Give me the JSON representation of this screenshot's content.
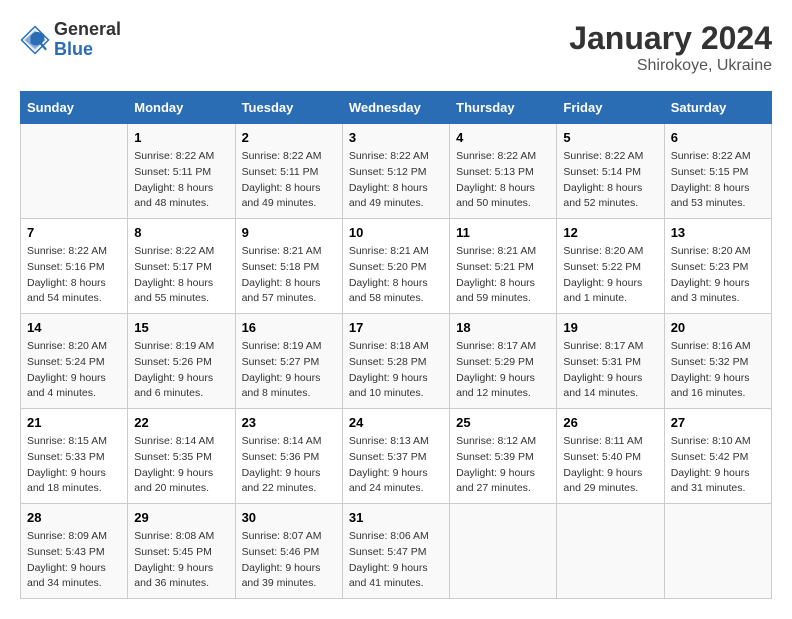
{
  "header": {
    "logo_general": "General",
    "logo_blue": "Blue",
    "title": "January 2024",
    "subtitle": "Shirokoye, Ukraine"
  },
  "columns": [
    "Sunday",
    "Monday",
    "Tuesday",
    "Wednesday",
    "Thursday",
    "Friday",
    "Saturday"
  ],
  "weeks": [
    [
      {
        "day": "",
        "sunrise": "",
        "sunset": "",
        "daylight": ""
      },
      {
        "day": "1",
        "sunrise": "Sunrise: 8:22 AM",
        "sunset": "Sunset: 5:11 PM",
        "daylight": "Daylight: 8 hours and 48 minutes."
      },
      {
        "day": "2",
        "sunrise": "Sunrise: 8:22 AM",
        "sunset": "Sunset: 5:11 PM",
        "daylight": "Daylight: 8 hours and 49 minutes."
      },
      {
        "day": "3",
        "sunrise": "Sunrise: 8:22 AM",
        "sunset": "Sunset: 5:12 PM",
        "daylight": "Daylight: 8 hours and 49 minutes."
      },
      {
        "day": "4",
        "sunrise": "Sunrise: 8:22 AM",
        "sunset": "Sunset: 5:13 PM",
        "daylight": "Daylight: 8 hours and 50 minutes."
      },
      {
        "day": "5",
        "sunrise": "Sunrise: 8:22 AM",
        "sunset": "Sunset: 5:14 PM",
        "daylight": "Daylight: 8 hours and 52 minutes."
      },
      {
        "day": "6",
        "sunrise": "Sunrise: 8:22 AM",
        "sunset": "Sunset: 5:15 PM",
        "daylight": "Daylight: 8 hours and 53 minutes."
      }
    ],
    [
      {
        "day": "7",
        "sunrise": "Sunrise: 8:22 AM",
        "sunset": "Sunset: 5:16 PM",
        "daylight": "Daylight: 8 hours and 54 minutes."
      },
      {
        "day": "8",
        "sunrise": "Sunrise: 8:22 AM",
        "sunset": "Sunset: 5:17 PM",
        "daylight": "Daylight: 8 hours and 55 minutes."
      },
      {
        "day": "9",
        "sunrise": "Sunrise: 8:21 AM",
        "sunset": "Sunset: 5:18 PM",
        "daylight": "Daylight: 8 hours and 57 minutes."
      },
      {
        "day": "10",
        "sunrise": "Sunrise: 8:21 AM",
        "sunset": "Sunset: 5:20 PM",
        "daylight": "Daylight: 8 hours and 58 minutes."
      },
      {
        "day": "11",
        "sunrise": "Sunrise: 8:21 AM",
        "sunset": "Sunset: 5:21 PM",
        "daylight": "Daylight: 8 hours and 59 minutes."
      },
      {
        "day": "12",
        "sunrise": "Sunrise: 8:20 AM",
        "sunset": "Sunset: 5:22 PM",
        "daylight": "Daylight: 9 hours and 1 minute."
      },
      {
        "day": "13",
        "sunrise": "Sunrise: 8:20 AM",
        "sunset": "Sunset: 5:23 PM",
        "daylight": "Daylight: 9 hours and 3 minutes."
      }
    ],
    [
      {
        "day": "14",
        "sunrise": "Sunrise: 8:20 AM",
        "sunset": "Sunset: 5:24 PM",
        "daylight": "Daylight: 9 hours and 4 minutes."
      },
      {
        "day": "15",
        "sunrise": "Sunrise: 8:19 AM",
        "sunset": "Sunset: 5:26 PM",
        "daylight": "Daylight: 9 hours and 6 minutes."
      },
      {
        "day": "16",
        "sunrise": "Sunrise: 8:19 AM",
        "sunset": "Sunset: 5:27 PM",
        "daylight": "Daylight: 9 hours and 8 minutes."
      },
      {
        "day": "17",
        "sunrise": "Sunrise: 8:18 AM",
        "sunset": "Sunset: 5:28 PM",
        "daylight": "Daylight: 9 hours and 10 minutes."
      },
      {
        "day": "18",
        "sunrise": "Sunrise: 8:17 AM",
        "sunset": "Sunset: 5:29 PM",
        "daylight": "Daylight: 9 hours and 12 minutes."
      },
      {
        "day": "19",
        "sunrise": "Sunrise: 8:17 AM",
        "sunset": "Sunset: 5:31 PM",
        "daylight": "Daylight: 9 hours and 14 minutes."
      },
      {
        "day": "20",
        "sunrise": "Sunrise: 8:16 AM",
        "sunset": "Sunset: 5:32 PM",
        "daylight": "Daylight: 9 hours and 16 minutes."
      }
    ],
    [
      {
        "day": "21",
        "sunrise": "Sunrise: 8:15 AM",
        "sunset": "Sunset: 5:33 PM",
        "daylight": "Daylight: 9 hours and 18 minutes."
      },
      {
        "day": "22",
        "sunrise": "Sunrise: 8:14 AM",
        "sunset": "Sunset: 5:35 PM",
        "daylight": "Daylight: 9 hours and 20 minutes."
      },
      {
        "day": "23",
        "sunrise": "Sunrise: 8:14 AM",
        "sunset": "Sunset: 5:36 PM",
        "daylight": "Daylight: 9 hours and 22 minutes."
      },
      {
        "day": "24",
        "sunrise": "Sunrise: 8:13 AM",
        "sunset": "Sunset: 5:37 PM",
        "daylight": "Daylight: 9 hours and 24 minutes."
      },
      {
        "day": "25",
        "sunrise": "Sunrise: 8:12 AM",
        "sunset": "Sunset: 5:39 PM",
        "daylight": "Daylight: 9 hours and 27 minutes."
      },
      {
        "day": "26",
        "sunrise": "Sunrise: 8:11 AM",
        "sunset": "Sunset: 5:40 PM",
        "daylight": "Daylight: 9 hours and 29 minutes."
      },
      {
        "day": "27",
        "sunrise": "Sunrise: 8:10 AM",
        "sunset": "Sunset: 5:42 PM",
        "daylight": "Daylight: 9 hours and 31 minutes."
      }
    ],
    [
      {
        "day": "28",
        "sunrise": "Sunrise: 8:09 AM",
        "sunset": "Sunset: 5:43 PM",
        "daylight": "Daylight: 9 hours and 34 minutes."
      },
      {
        "day": "29",
        "sunrise": "Sunrise: 8:08 AM",
        "sunset": "Sunset: 5:45 PM",
        "daylight": "Daylight: 9 hours and 36 minutes."
      },
      {
        "day": "30",
        "sunrise": "Sunrise: 8:07 AM",
        "sunset": "Sunset: 5:46 PM",
        "daylight": "Daylight: 9 hours and 39 minutes."
      },
      {
        "day": "31",
        "sunrise": "Sunrise: 8:06 AM",
        "sunset": "Sunset: 5:47 PM",
        "daylight": "Daylight: 9 hours and 41 minutes."
      },
      {
        "day": "",
        "sunrise": "",
        "sunset": "",
        "daylight": ""
      },
      {
        "day": "",
        "sunrise": "",
        "sunset": "",
        "daylight": ""
      },
      {
        "day": "",
        "sunrise": "",
        "sunset": "",
        "daylight": ""
      }
    ]
  ]
}
